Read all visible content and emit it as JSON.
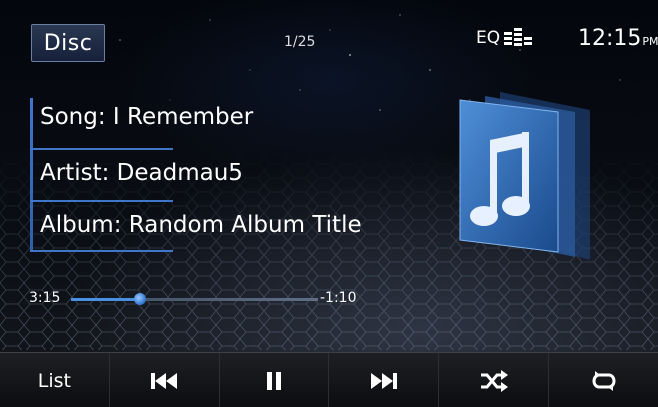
{
  "header": {
    "source_label": "Disc",
    "track_counter": "1/25",
    "eq_label": "EQ",
    "clock_time": "12:15",
    "clock_ampm": "PM"
  },
  "now_playing": {
    "song": "Song: I Remember",
    "artist": "Artist: Deadmau5",
    "album": "Album: Random Album Title"
  },
  "progress": {
    "elapsed": "3:15",
    "remaining": "-1:10",
    "fraction": 0.28
  },
  "bottom_bar": {
    "list_label": "List",
    "icons": [
      "previous-track-icon",
      "pause-icon",
      "next-track-icon",
      "shuffle-icon",
      "repeat-icon"
    ]
  },
  "colors": {
    "accent": "#3f76c9",
    "progress_fill": "#4a90e2",
    "bar_background": "#16181c"
  }
}
